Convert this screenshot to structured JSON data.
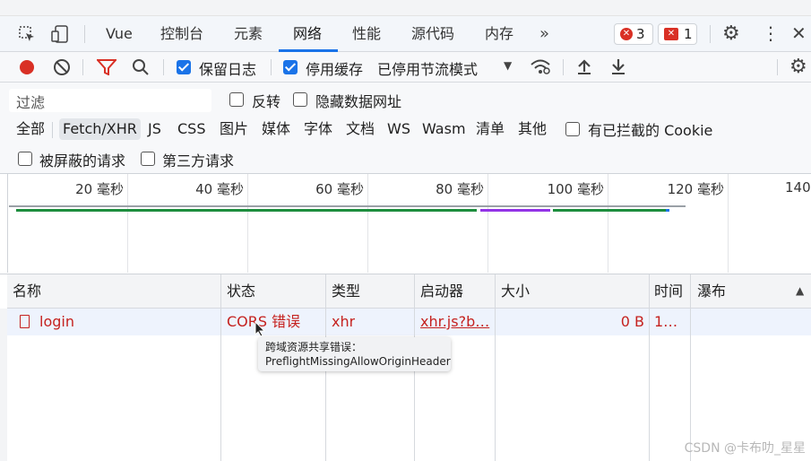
{
  "tabs": [
    {
      "label": "Vue"
    },
    {
      "label": "控制台"
    },
    {
      "label": "元素"
    },
    {
      "label": "网络",
      "active": true
    },
    {
      "label": "性能"
    },
    {
      "label": "源代码"
    },
    {
      "label": "内存"
    }
  ],
  "badges": {
    "errors": "3",
    "issues": "1"
  },
  "toolbar": {
    "preserve_log": "保留日志",
    "disable_cache": "停用缓存",
    "throttling": "已停用节流模式"
  },
  "filter": {
    "placeholder": "过滤",
    "invert": "反转",
    "hide_data_urls": "隐藏数据网址",
    "types": [
      "全部",
      "Fetch/XHR",
      "JS",
      "CSS",
      "图片",
      "媒体",
      "字体",
      "文档",
      "WS",
      "Wasm",
      "清单",
      "其他"
    ],
    "blocked_cookies": "有已拦截的 Cookie",
    "blocked_requests": "被屏蔽的请求",
    "third_party": "第三方请求"
  },
  "timeline": {
    "ticks": [
      "20 毫秒",
      "40 毫秒",
      "60 毫秒",
      "80 毫秒",
      "100 毫秒",
      "120 毫秒",
      "140"
    ]
  },
  "table": {
    "columns": [
      "名称",
      "状态",
      "类型",
      "启动器",
      "大小",
      "时间",
      "瀑布"
    ],
    "rows": [
      {
        "name": "login",
        "status": "CORS 错误",
        "type": "xhr",
        "initiator": "xhr.js?b…",
        "size": "0 B",
        "time": "1…"
      }
    ]
  },
  "tooltip": {
    "line1": "跨域资源共享错误：",
    "line2": "PreflightMissingAllowOriginHeader"
  },
  "watermark": "CSDN @卡布叻_星星",
  "colors": {
    "accent": "#1a73e8",
    "error": "#c5221f",
    "record": "#d93025"
  }
}
